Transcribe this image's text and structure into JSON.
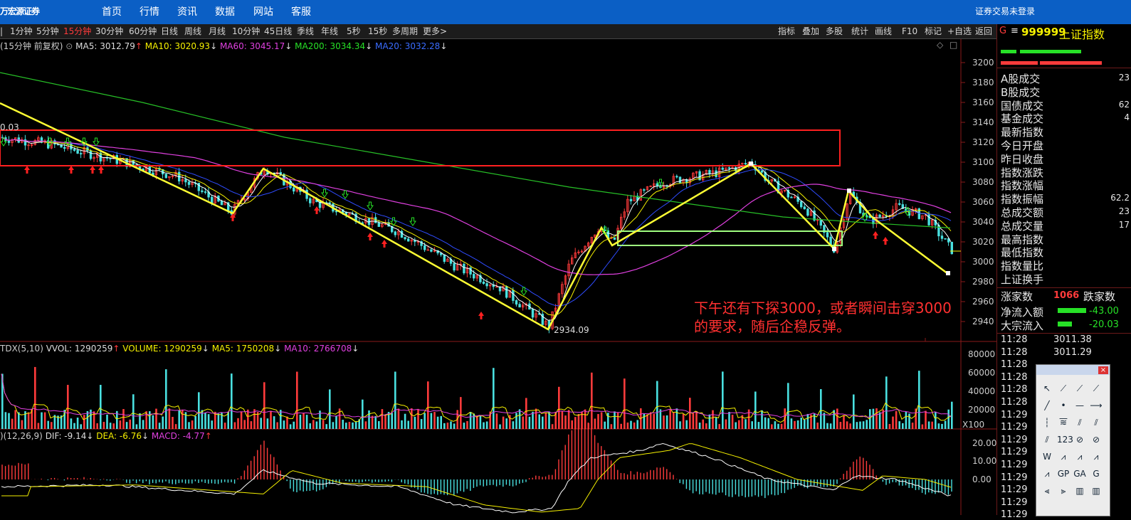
{
  "topbar": {
    "logo": "万宏源证券",
    "nav": [
      "首页",
      "行情",
      "资讯",
      "数据",
      "网站",
      "客服"
    ],
    "login_status": "证券交易未登录"
  },
  "toolbar": {
    "periods": [
      "1分钟",
      "5分钟",
      "15分钟",
      "30分钟",
      "60分钟",
      "日线",
      "周线",
      "月线",
      "10分钟",
      "45日线",
      "季线",
      "年线",
      "5秒",
      "15秒",
      "多周期",
      "更多>"
    ],
    "active_period": "15分钟",
    "tools": [
      "指标",
      "叠加",
      "多股",
      "统计",
      "画线",
      "F10",
      "标记",
      "+自选",
      "返回"
    ]
  },
  "chart_header": {
    "name": "(15分钟 前复权)",
    "ma5": "MA5: 3012.79",
    "ma10": "MA10: 3020.93",
    "ma60": "MA60: 3045.17",
    "ma200": "MA200: 3034.34",
    "ma20": "MA20: 3032.28",
    "left_price": "0.03",
    "low_label": "2934.09"
  },
  "annotation": {
    "line1": "下午还有下探3000，或者瞬间击穿3000",
    "line2": "的要求，随后企稳反弹。"
  },
  "vol_header": {
    "name": "TDX(5,10)",
    "vvol": "VVOL: 1290259",
    "volume": "VOLUME: 1290259",
    "ma5": "MA5: 1750208",
    "ma10": "MA10: 2766708"
  },
  "macd_header": {
    "name": ")(12,26,9)",
    "dif": "DIF: -9.14",
    "dea": "DEA: -6.76",
    "macd": "MACD: -4.77"
  },
  "price_axis": [
    "3200",
    "3180",
    "3160",
    "3140",
    "3120",
    "3100",
    "3080",
    "3060",
    "3040",
    "3020",
    "3000",
    "2980",
    "2960",
    "2940"
  ],
  "vol_axis": [
    "80000",
    "60000",
    "40000",
    "20000",
    "X100"
  ],
  "macd_axis": [
    "20.00",
    "10.00",
    "0.00"
  ],
  "colors": {
    "up": "#ff3b3b",
    "down": "#49e0e0",
    "ma5": "#ffffff",
    "ma10": "#f5f000",
    "ma20": "#2f4cff",
    "ma60": "#e040e0",
    "ma200": "#27c027",
    "drawn": "#ffff33",
    "box": "#ff2020",
    "box2": "#a0ff80"
  },
  "right_panel": {
    "code": "999999",
    "name": "上证指数",
    "g_label": "G",
    "rows": [
      {
        "label": "A股成交",
        "value": "23"
      },
      {
        "label": "B股成交",
        "value": ""
      },
      {
        "label": "国债成交",
        "value": "62"
      },
      {
        "label": "基金成交",
        "value": "4"
      },
      {
        "label": "最新指数",
        "value": ""
      },
      {
        "label": "今日开盘",
        "value": ""
      },
      {
        "label": "昨日收盘",
        "value": ""
      },
      {
        "label": "指数涨跌",
        "value": ""
      },
      {
        "label": "指数涨幅",
        "value": ""
      },
      {
        "label": "指数振幅",
        "value": "62.2"
      },
      {
        "label": "总成交额",
        "value": "23"
      },
      {
        "label": "总成交量",
        "value": "17"
      },
      {
        "label": "最高指数",
        "value": ""
      },
      {
        "label": "最低指数",
        "value": ""
      },
      {
        "label": "指数量比",
        "value": ""
      },
      {
        "label": "上证换手",
        "value": ""
      }
    ],
    "rise_label": "涨家数",
    "rise_value": "1066",
    "fall_label": "跌家数",
    "net_inflow_label": "净流入额",
    "net_inflow_value": "-43.00",
    "block_inflow_label": "大宗流入",
    "block_inflow_value": "-20.03",
    "ticks": [
      {
        "time": "11:28",
        "price": "3011.38"
      },
      {
        "time": "11:28",
        "price": "3011.29"
      },
      {
        "time": "11:28",
        "price": ""
      },
      {
        "time": "11:28",
        "price": ""
      },
      {
        "time": "11:28",
        "price": ""
      },
      {
        "time": "11:28",
        "price": ""
      },
      {
        "time": "11:29",
        "price": ""
      },
      {
        "time": "11:29",
        "price": ""
      },
      {
        "time": "11:29",
        "price": ""
      },
      {
        "time": "11:29",
        "price": ""
      },
      {
        "time": "11:29",
        "price": ""
      },
      {
        "time": "11:29",
        "price": ""
      },
      {
        "time": "11:29",
        "price": ""
      },
      {
        "time": "11:29",
        "price": ""
      },
      {
        "time": "11:29",
        "price": ""
      }
    ]
  },
  "draw_tools": [
    "↖",
    "⟋",
    "⟋",
    "⟋",
    "╱",
    "•—",
    "—",
    "⟶",
    "┆",
    "≋",
    "⫽",
    "⫽",
    "⫽",
    "123",
    "⊘",
    "⊘",
    "W",
    "⩘",
    "⩘",
    "⩘",
    "⩘",
    "GP",
    "GA",
    "G",
    "⫷",
    "⫸",
    "▥",
    "▥"
  ]
}
